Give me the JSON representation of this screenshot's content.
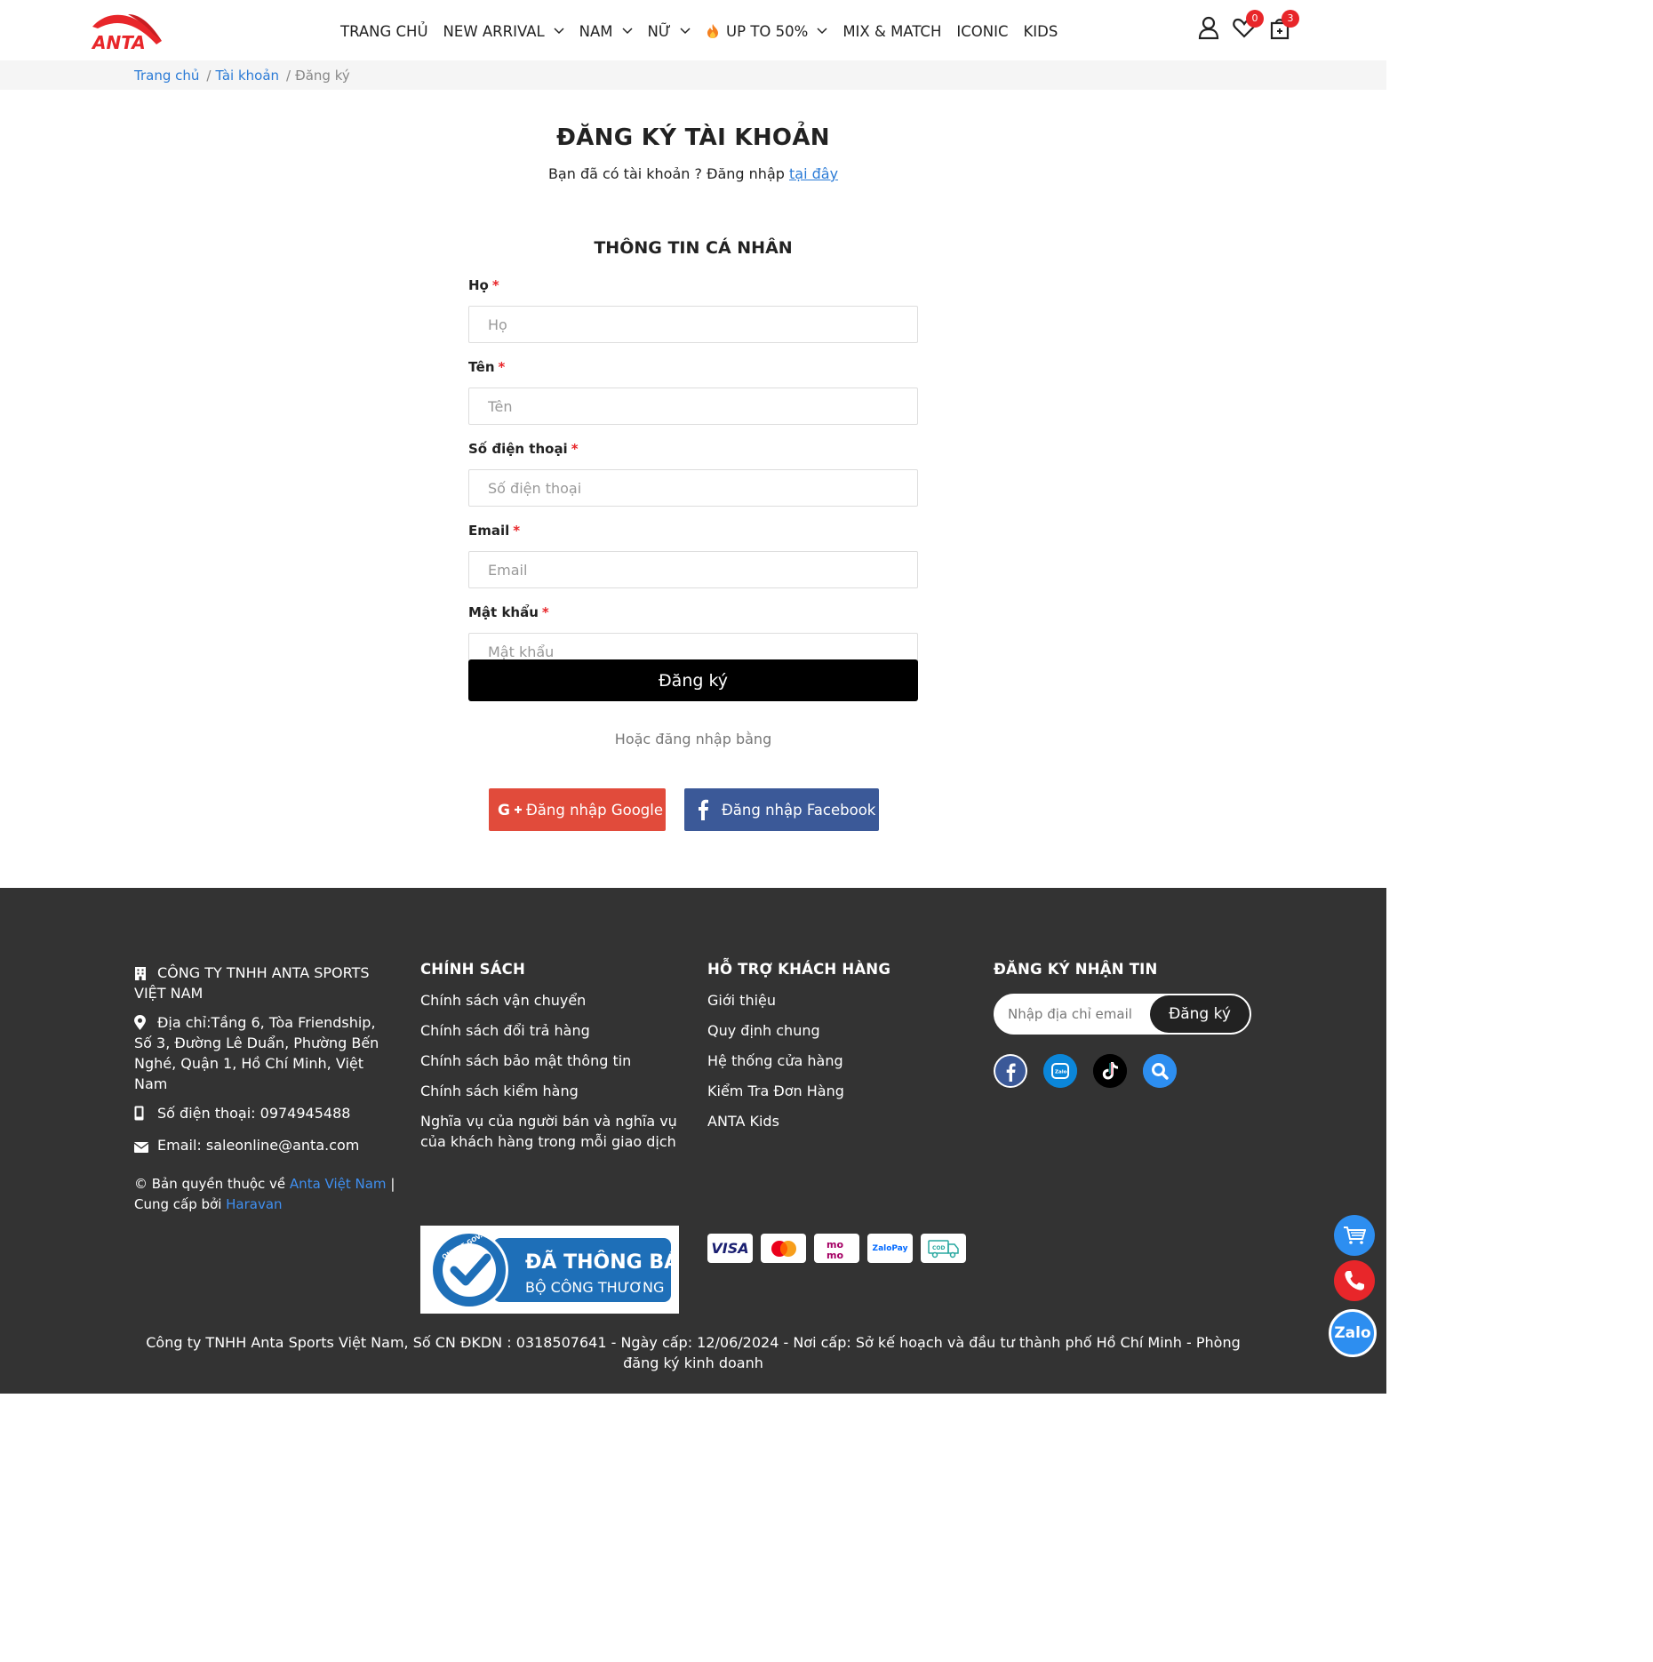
{
  "header": {
    "logo_text": "ANTA",
    "nav": [
      {
        "label": "TRANG CHỦ",
        "dropdown": false
      },
      {
        "label": "NEW ARRIVAL",
        "dropdown": true
      },
      {
        "label": "NAM",
        "dropdown": true
      },
      {
        "label": "NỮ",
        "dropdown": true
      },
      {
        "label": "UP TO 50%",
        "dropdown": true,
        "icon": "fire-icon"
      },
      {
        "label": "MIX & MATCH",
        "dropdown": false
      },
      {
        "label": "ICONIC",
        "dropdown": false
      },
      {
        "label": "KIDS",
        "dropdown": false
      }
    ],
    "wishlist_count": "0",
    "cart_count": "3"
  },
  "breadcrumb": {
    "home": "Trang chủ",
    "account": "Tài khoản",
    "current": "Đăng ký",
    "separator": "/"
  },
  "main": {
    "title": "ĐĂNG KÝ TÀI KHOẢN",
    "subtitle_prefix": "Bạn đã có tài khoản ? Đăng nhập",
    "subtitle_link": "tại đây",
    "section_title": "THÔNG TIN CÁ NHÂN",
    "fields": {
      "last_name": {
        "label": "Họ",
        "placeholder": "Họ",
        "required": "*"
      },
      "first_name": {
        "label": "Tên",
        "placeholder": "Tên",
        "required": "*"
      },
      "phone": {
        "label": "Số điện thoại",
        "placeholder": "Số điện thoại",
        "required": "*"
      },
      "email": {
        "label": "Email",
        "placeholder": "Email",
        "required": "*"
      },
      "password": {
        "label": "Mật khẩu",
        "placeholder": "Mật khẩu",
        "required": "*"
      }
    },
    "submit_label": "Đăng ký",
    "or_text": "Hoặc đăng nhập bằng",
    "google_label": "Đăng nhập Google",
    "facebook_label": "Đăng nhập Facebook"
  },
  "footer": {
    "company": {
      "name": "CÔNG TY TNHH ANTA SPORTS VIỆT NAM",
      "address": "Địa chỉ:Tầng 6, Tòa Friendship, Số 3, Đường Lê Duẩn, Phường Bến Nghé, Quận 1, Hồ Chí Minh, Việt Nam",
      "phone": "Số điện thoại: 0974945488",
      "email": "Email: saleonline@anta.com",
      "copyright_prefix": "© Bản quyền thuộc về",
      "copyright_brand": "Anta Việt Nam",
      "copyright_sep": "|",
      "provider_prefix": "Cung cấp bởi",
      "provider": "Haravan"
    },
    "policy": {
      "heading": "CHÍNH SÁCH",
      "links": [
        "Chính sách vận chuyển",
        "Chính sách đổi trả hàng",
        "Chính sách bảo mật thông tin",
        "Chính sách kiểm hàng",
        "Nghĩa vụ của người bán và nghĩa vụ của khách hàng trong mỗi giao dịch"
      ]
    },
    "support": {
      "heading": "HỖ TRỢ KHÁCH HÀNG",
      "links": [
        "Giới thiệu",
        "Quy định chung",
        "Hệ thống cửa hàng",
        "Kiểm Tra Đơn Hàng",
        "ANTA Kids"
      ]
    },
    "newsletter": {
      "heading": "ĐĂNG KÝ NHẬN TIN",
      "placeholder": "Nhập địa chỉ email",
      "button": "Đăng ký"
    },
    "badge": {
      "line1": "ĐÃ THÔNG BÁO",
      "line2": "BỘ CÔNG THƯƠNG",
      "ring_text": "ONLINE.GOV.VN"
    },
    "payments": [
      "VISA",
      "mastercard",
      "momo",
      "ZaloPay",
      "COD"
    ],
    "legal": "Công ty TNHH Anta Sports Việt Nam, Số CN ĐKDN : 0318507641 - Ngày cấp: 12/06/2024 - Nơi cấp: Sở kế hoạch và đầu tư thành phố Hồ Chí Minh - Phòng đăng ký kinh doanh"
  },
  "floating": {
    "zalo_label": "Zalo"
  },
  "colors": {
    "brand_red": "#e8262a",
    "link_blue": "#2b7bd6",
    "google": "#e14b3b",
    "facebook": "#3b5998",
    "footer_bg": "#333333"
  }
}
